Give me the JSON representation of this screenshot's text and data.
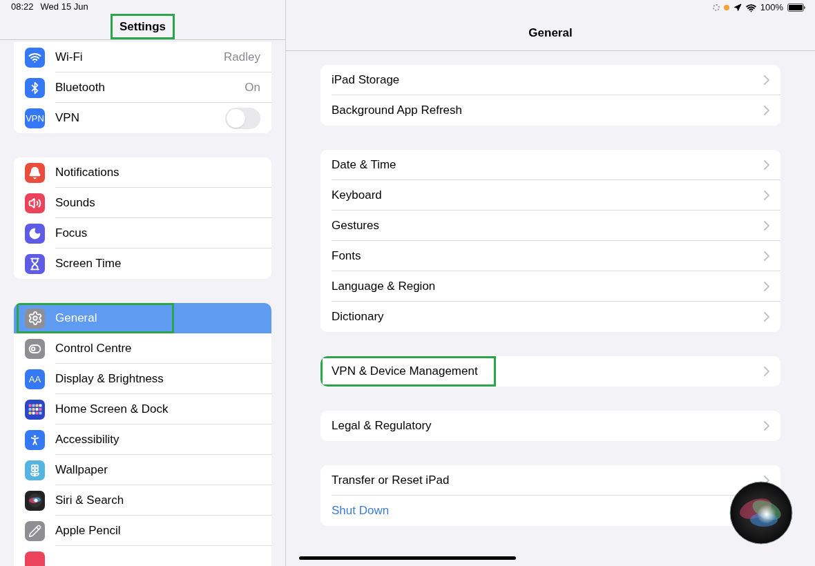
{
  "status_bar": {
    "time": "08:22",
    "date": "Wed 15 Jun",
    "recording_indicator": true,
    "battery": "100%"
  },
  "sidebar": {
    "title": "Settings",
    "title_annotated": true,
    "groups": [
      [
        {
          "label": "Wi-Fi",
          "color": "#3478f6",
          "kind": "link",
          "value": "Radley",
          "selected": false,
          "annotated": false
        },
        {
          "label": "Bluetooth",
          "color": "#3478f6",
          "kind": "link",
          "value": "On",
          "selected": false,
          "annotated": false
        },
        {
          "label": "VPN",
          "icon_text": "VPN",
          "color": "#3478f6",
          "kind": "toggle",
          "on": false,
          "selected": false,
          "annotated": false
        }
      ],
      [
        {
          "label": "Notifications",
          "color": "#eb4d3d",
          "kind": "link",
          "selected": false,
          "annotated": false
        },
        {
          "label": "Sounds",
          "color": "#eb445a",
          "kind": "link",
          "selected": false,
          "annotated": false
        },
        {
          "label": "Focus",
          "color": "#5e5ce6",
          "kind": "link",
          "selected": false,
          "annotated": false
        },
        {
          "label": "Screen Time",
          "color": "#5e5ce6",
          "kind": "link",
          "selected": false,
          "annotated": false
        }
      ],
      [
        {
          "label": "General",
          "color": "#8e8e93",
          "kind": "link",
          "selected": true,
          "annotated": true
        },
        {
          "label": "Control Centre",
          "color": "#8e8e93",
          "kind": "link",
          "selected": false,
          "annotated": false
        },
        {
          "label": "Display & Brightness",
          "icon_text": "AA",
          "color": "#3478f6",
          "kind": "link",
          "selected": false,
          "annotated": false
        },
        {
          "label": "Home Screen & Dock",
          "color": "#2c46c8",
          "kind": "link",
          "selected": false,
          "annotated": false
        },
        {
          "label": "Accessibility",
          "color": "#3478f6",
          "kind": "link",
          "selected": false,
          "annotated": false
        },
        {
          "label": "Wallpaper",
          "color": "#55b4e0",
          "kind": "link",
          "selected": false,
          "annotated": false
        },
        {
          "label": "Siri & Search",
          "color": "#222222",
          "kind": "link",
          "selected": false,
          "annotated": false
        },
        {
          "label": "Apple Pencil",
          "color": "#8e8e93",
          "kind": "link",
          "selected": false,
          "annotated": false
        },
        {
          "color": "#eb445a",
          "kind": "link",
          "selected": false,
          "annotated": false
        }
      ]
    ]
  },
  "detail": {
    "title": "General",
    "groups": [
      [
        {
          "label": "iPad Storage",
          "kind": "link",
          "annotated": false
        },
        {
          "label": "Background App Refresh",
          "kind": "link",
          "annotated": false
        }
      ],
      [
        {
          "label": "Date & Time",
          "kind": "link",
          "annotated": false
        },
        {
          "label": "Keyboard",
          "kind": "link",
          "annotated": false
        },
        {
          "label": "Gestures",
          "kind": "link",
          "annotated": false
        },
        {
          "label": "Fonts",
          "kind": "link",
          "annotated": false
        },
        {
          "label": "Language & Region",
          "kind": "link",
          "annotated": false
        },
        {
          "label": "Dictionary",
          "kind": "link",
          "annotated": false
        }
      ],
      [
        {
          "label": "VPN & Device Management",
          "kind": "link",
          "annotated": true
        }
      ],
      [
        {
          "label": "Legal & Regulatory",
          "kind": "link",
          "annotated": false
        }
      ],
      [
        {
          "label": "Transfer or Reset iPad",
          "kind": "link",
          "annotated": false
        },
        {
          "label": "Shut Down",
          "kind": "action",
          "annotated": false
        }
      ]
    ]
  }
}
